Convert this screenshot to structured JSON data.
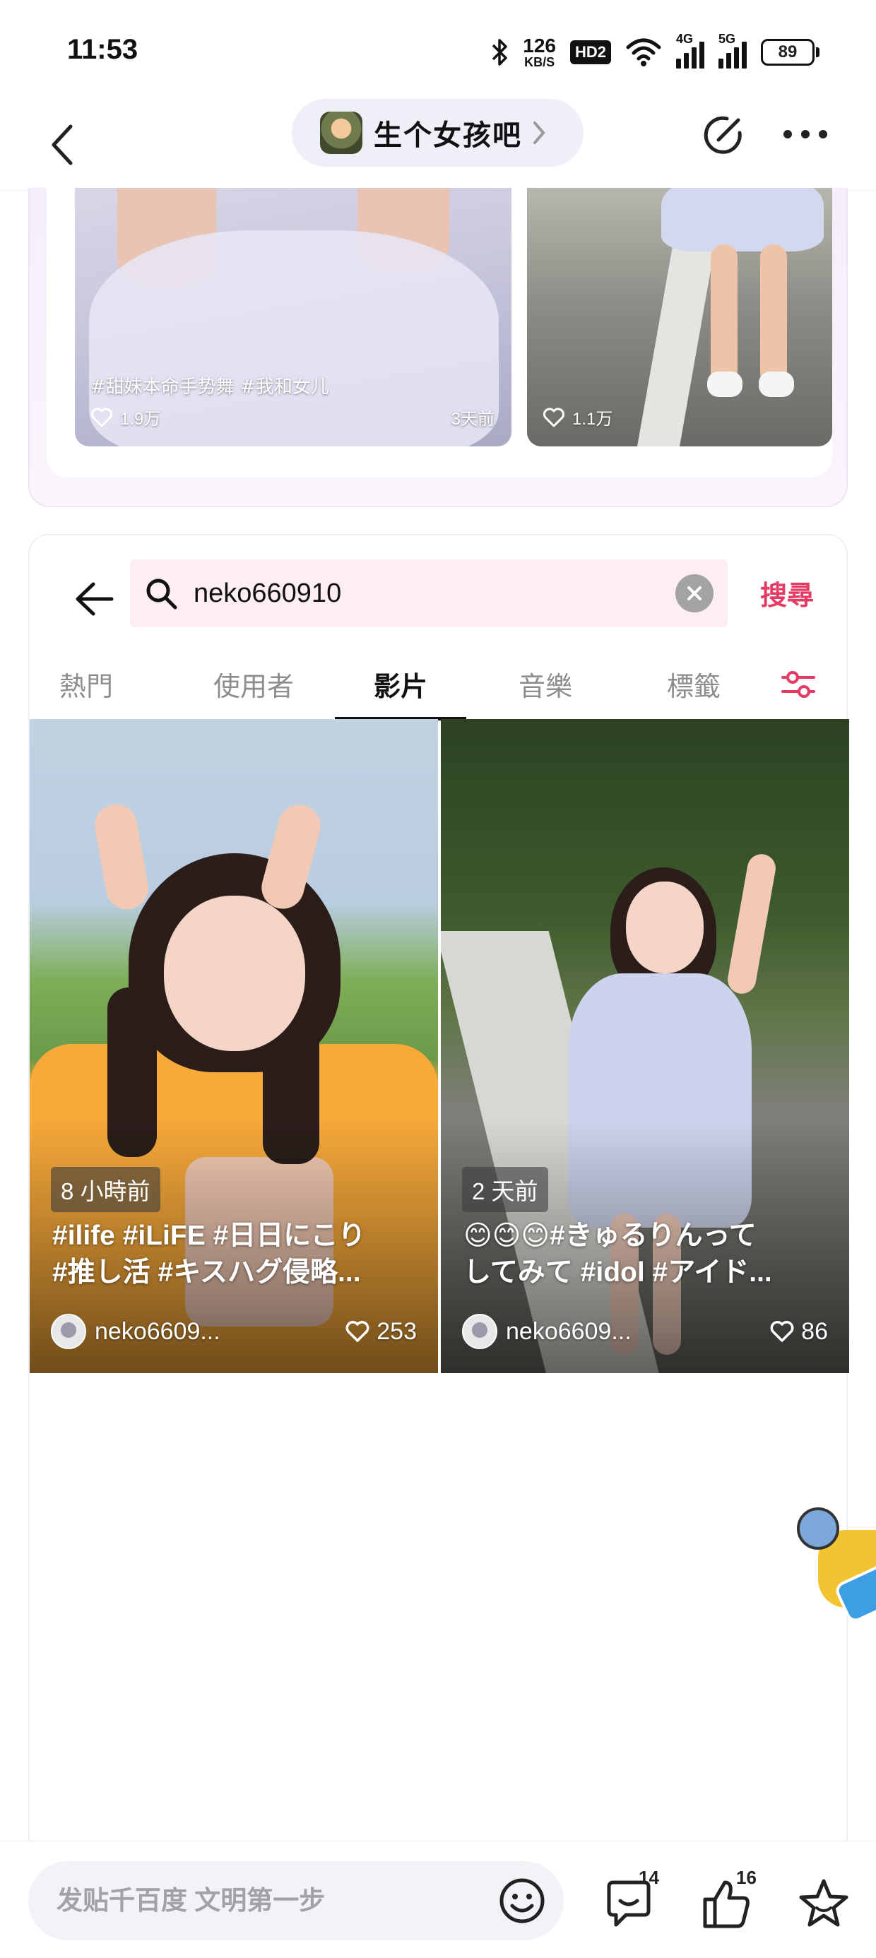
{
  "status_bar": {
    "time": "11:53",
    "net_speed_value": "126",
    "net_speed_unit": "KB/S",
    "hd_label": "HD2",
    "network_4g": "4G",
    "network_5g": "5G",
    "battery": "89"
  },
  "header": {
    "forum_name": "生个女孩吧"
  },
  "previous_post": {
    "thumbnails": [
      {
        "caption": "#甜妹本命手势舞 #我和女儿",
        "likes": "1.9万",
        "age": "3天前"
      },
      {
        "caption": "",
        "likes": "1.1万",
        "age": ""
      }
    ]
  },
  "search": {
    "query": "neko660910",
    "submit_label": "搜尋",
    "tabs": [
      "熱門",
      "使用者",
      "影片",
      "音樂",
      "標籤"
    ],
    "active_tab": "影片"
  },
  "videos": [
    {
      "time": "8 小時前",
      "title_line1": "#ilife #iLiFE #日日にこり",
      "title_line2": "#推し活 #キスハグ侵略...",
      "author": "neko6609...",
      "likes": "253"
    },
    {
      "time": "2 天前",
      "title_line1": "😊😊😊#きゅるりんって",
      "title_line2": "してみて #idol #アイド...",
      "author": "neko6609...",
      "likes": "86"
    }
  ],
  "bottom_bar": {
    "comment_placeholder": "发贴千百度 文明第一步",
    "comment_count": "14",
    "like_count": "16"
  },
  "colors": {
    "accent": "#e33b63",
    "search_bg": "#fdeff1",
    "pill_bg": "#efeff8"
  }
}
